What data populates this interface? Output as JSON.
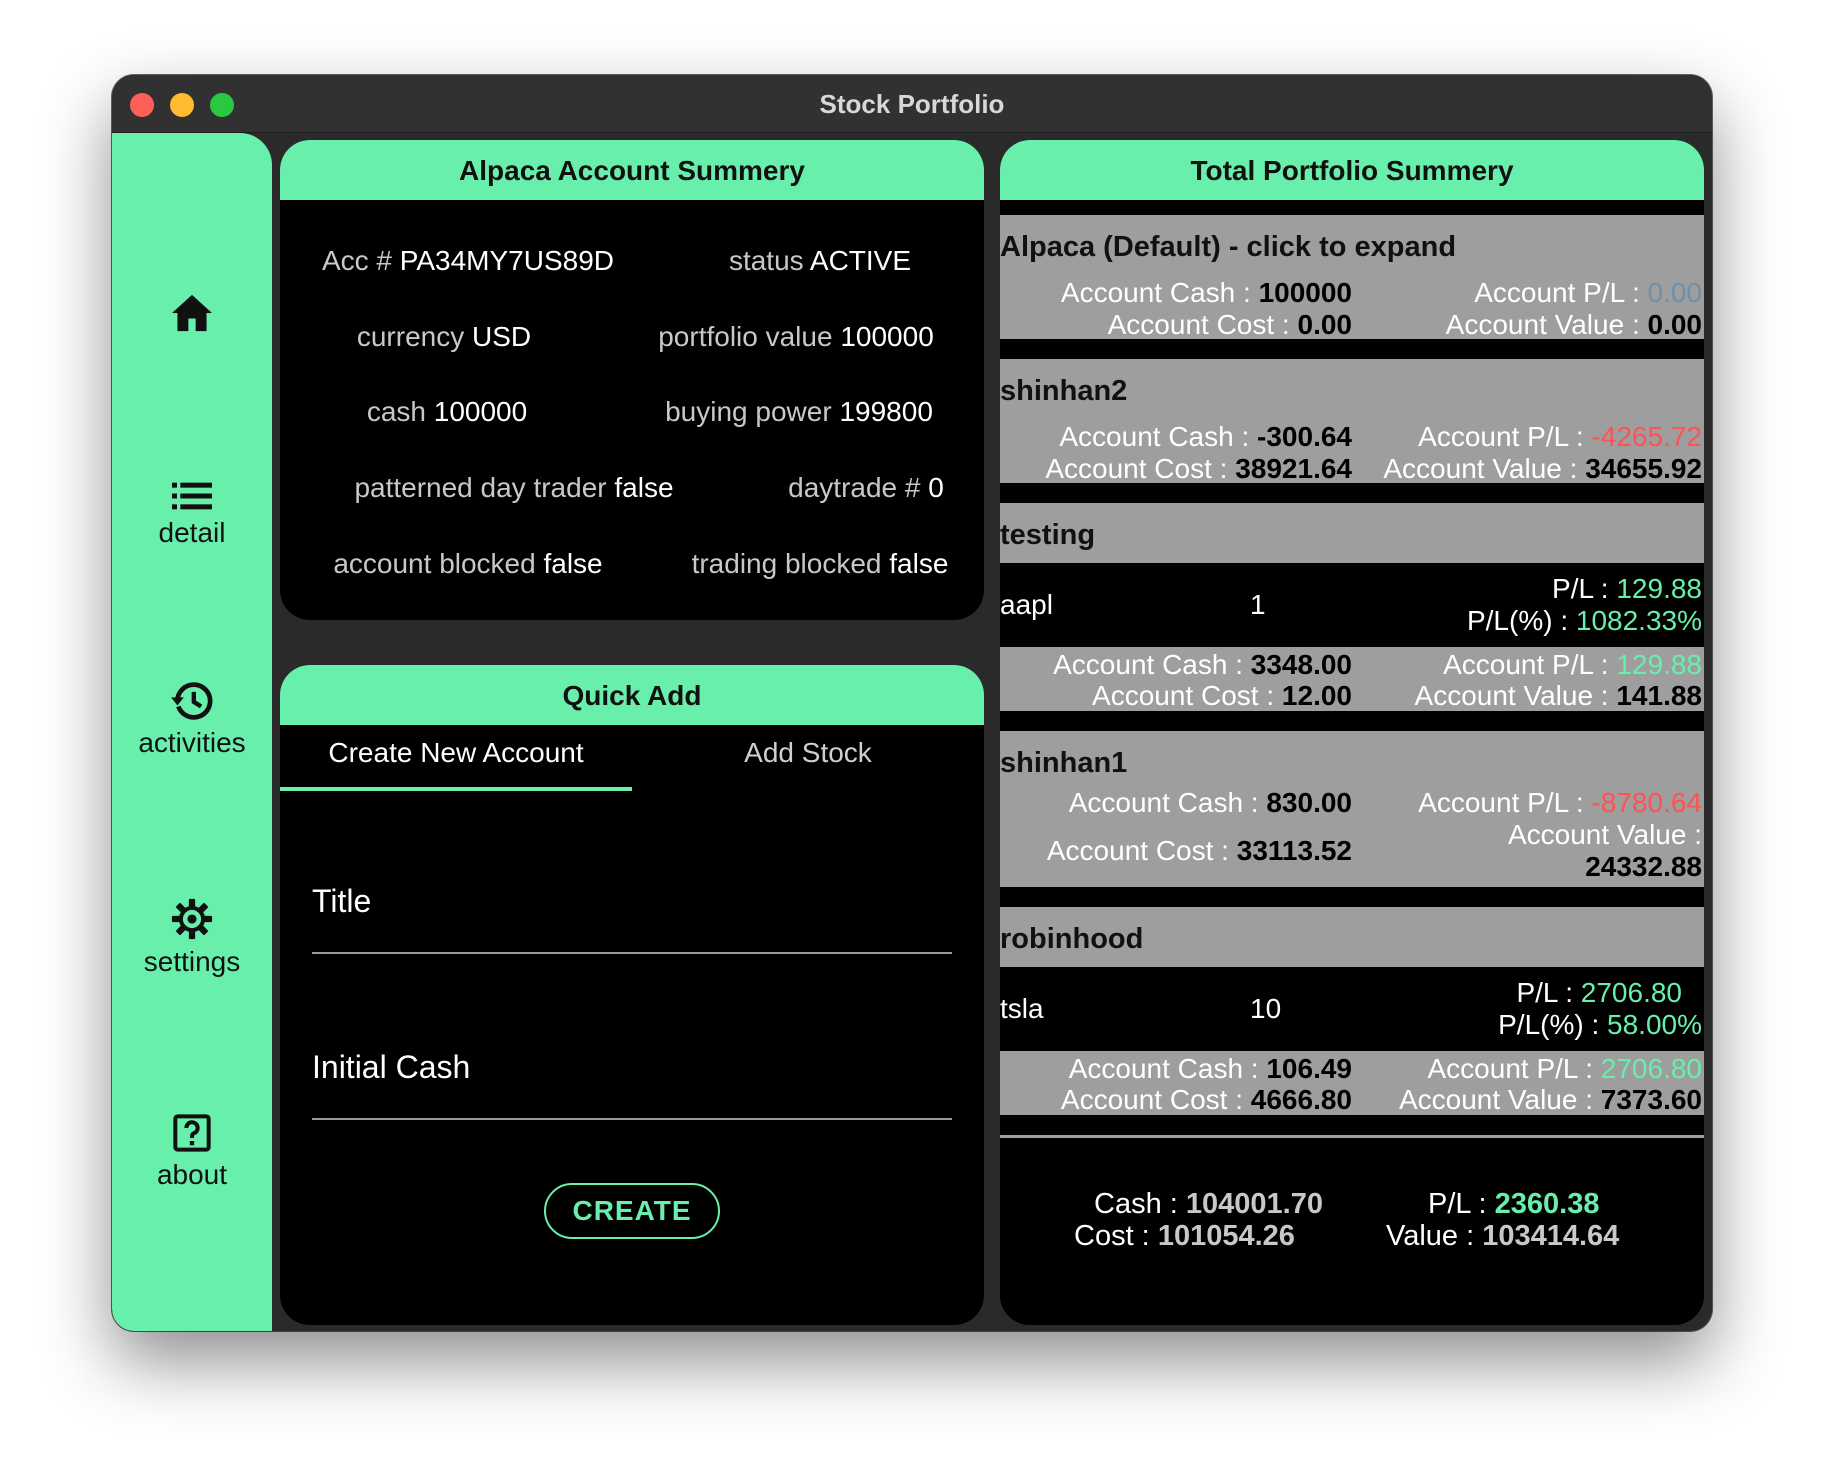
{
  "window": {
    "title": "Stock Portfolio"
  },
  "sidebar": {
    "items": [
      {
        "label": "",
        "icon": "home-icon"
      },
      {
        "label": "detail",
        "icon": "list-icon"
      },
      {
        "label": "activities",
        "icon": "history-icon"
      },
      {
        "label": "settings",
        "icon": "gear-icon"
      },
      {
        "label": "about",
        "icon": "help-icon"
      }
    ]
  },
  "alpaca": {
    "title": "Alpaca Account Summery",
    "fields": [
      {
        "label": "Acc #",
        "value": "PA34MY7US89D"
      },
      {
        "label": "status",
        "value": "ACTIVE"
      },
      {
        "label": "currency",
        "value": "USD"
      },
      {
        "label": "portfolio value",
        "value": "100000"
      },
      {
        "label": "cash",
        "value": "100000"
      },
      {
        "label": "buying power",
        "value": "199800"
      },
      {
        "label": "patterned day trader",
        "value": "false"
      },
      {
        "label": "daytrade #",
        "value": "0"
      },
      {
        "label": "account blocked",
        "value": "false"
      },
      {
        "label": "trading blocked",
        "value": "false"
      }
    ]
  },
  "quick_add": {
    "title": "Quick Add",
    "tabs": [
      "Create New Account",
      "Add Stock"
    ],
    "fields": [
      {
        "label": "Title",
        "value": ""
      },
      {
        "label": "Initial Cash",
        "value": ""
      }
    ],
    "create_label": "CREATE"
  },
  "total": {
    "title": "Total Portfolio Summery",
    "labels": {
      "cash": "Account Cash :",
      "pl": "Account P/L :",
      "cost": "Account Cost :",
      "value": "Account Value :",
      "stock_pl": "P/L :",
      "stock_plpct": "P/L(%) :"
    },
    "accounts": [
      {
        "name": "Alpaca (Default) - click to expand",
        "cash": "100000",
        "pl": "0.00",
        "cost": "0.00",
        "value": "0.00",
        "stocks": []
      },
      {
        "name": "shinhan2",
        "cash": "-300.64",
        "pl": "-4265.72",
        "cost": "38921.64",
        "value": "34655.92",
        "stocks": []
      },
      {
        "name": "testing",
        "cash": "3348.00",
        "pl": "129.88",
        "cost": "12.00",
        "value": "141.88",
        "stocks": [
          {
            "symbol": "aapl",
            "qty": "1",
            "pl": "129.88",
            "pl_pct": "1082.33%"
          }
        ]
      },
      {
        "name": "shinhan1",
        "cash": "830.00",
        "pl": "-8780.64",
        "cost": "33113.52",
        "value": "24332.88",
        "stocks": []
      },
      {
        "name": "robinhood",
        "cash": "106.49",
        "pl": "2706.80",
        "cost": "4666.80",
        "value": "7373.60",
        "stocks": [
          {
            "symbol": "tsla",
            "qty": "10",
            "pl": "2706.80",
            "pl_pct": "58.00%"
          }
        ]
      }
    ],
    "totals": {
      "cash_label": "Cash :",
      "cash": "104001.70",
      "cost_label": "Cost :",
      "cost": "101054.26",
      "pl_label": "P/L :",
      "pl": "2360.38",
      "value_label": "Value :",
      "value": "103414.64"
    }
  },
  "colors": {
    "accent": "#69efac",
    "negative": "#ff5252",
    "row_grey": "#9e9e9e",
    "panel_bg": "#000000"
  }
}
